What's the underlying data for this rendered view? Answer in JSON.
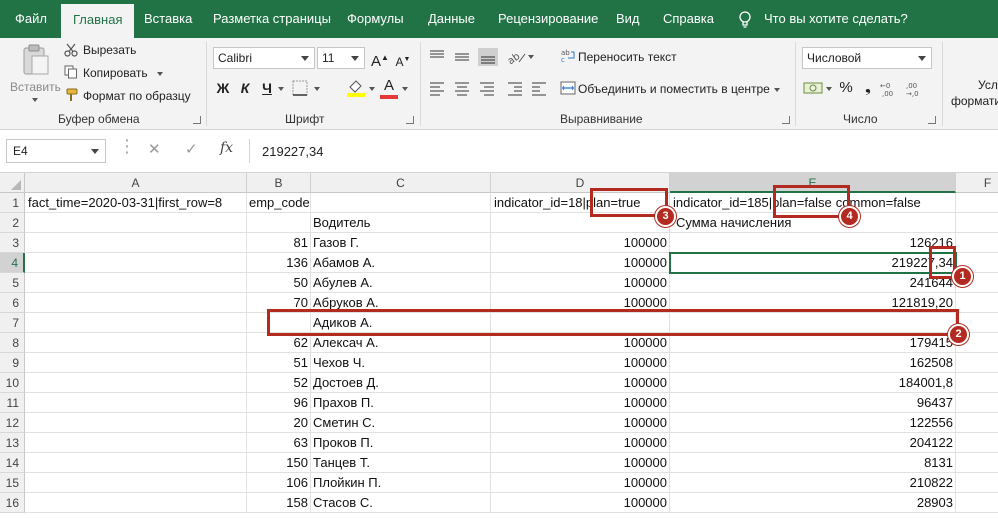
{
  "tabs": [
    {
      "label": "Файл",
      "active": false
    },
    {
      "label": "Главная",
      "active": true
    },
    {
      "label": "Вставка",
      "active": false
    },
    {
      "label": "Разметка страницы",
      "active": false
    },
    {
      "label": "Формулы",
      "active": false
    },
    {
      "label": "Данные",
      "active": false
    },
    {
      "label": "Рецензирование",
      "active": false
    },
    {
      "label": "Вид",
      "active": false
    },
    {
      "label": "Справка",
      "active": false
    }
  ],
  "tell_me": "Что вы хотите сделать?",
  "clipboard": {
    "paste": "Вставить",
    "cut": "Вырезать",
    "copy": "Копировать",
    "format_painter": "Формат по образцу",
    "label": "Буфер обмена"
  },
  "font": {
    "name": "Calibri",
    "size": "11",
    "bold": "Ж",
    "italic": "К",
    "underline": "Ч",
    "label": "Шрифт"
  },
  "alignment": {
    "wrap_text": "Переносить текст",
    "merge_center": "Объединить и поместить в центре",
    "label": "Выравнивание"
  },
  "number": {
    "format": "Числовой",
    "label": "Число"
  },
  "styles": {
    "cond_line1": "Усл",
    "cond_line2": "форматир"
  },
  "formula_bar": {
    "name_box": "E4",
    "fx": "fx",
    "content": "219227,34"
  },
  "columns": [
    "A",
    "B",
    "C",
    "D",
    "E",
    "F"
  ],
  "selected_column": "E",
  "selected_row": "4",
  "rows": [
    {
      "n": "1",
      "a": "fact_time=2020-03-31|first_row=8",
      "b": "emp_code",
      "c": "",
      "d": "indicator_id=18",
      "d2": "|plan=true",
      "e": "indicator_id=185",
      "e2": "|plan=false",
      "e3": "common=false"
    },
    {
      "n": "2",
      "a": "",
      "b": "",
      "c": "Водитель",
      "d": "",
      "e": "Сумма начисления"
    },
    {
      "n": "3",
      "a": "",
      "b": "81",
      "c": "Газов Г.",
      "d": "100000",
      "e": "126216"
    },
    {
      "n": "4",
      "a": "",
      "b": "136",
      "c": "Абамов А.",
      "d": "100000",
      "e": "219227,34"
    },
    {
      "n": "5",
      "a": "",
      "b": "50",
      "c": "Абулев А.",
      "d": "100000",
      "e": "241644"
    },
    {
      "n": "6",
      "a": "",
      "b": "70",
      "c": "Абруков А.",
      "d": "100000",
      "e": "121819,20"
    },
    {
      "n": "7",
      "a": "",
      "b": "",
      "c": "Адиков А.",
      "d": "",
      "e": ""
    },
    {
      "n": "8",
      "a": "",
      "b": "62",
      "c": "Алексач А.",
      "d": "100000",
      "e": "179415"
    },
    {
      "n": "9",
      "a": "",
      "b": "51",
      "c": "Чехов Ч.",
      "d": "100000",
      "e": "162508"
    },
    {
      "n": "10",
      "a": "",
      "b": "52",
      "c": "Достоев Д.",
      "d": "100000",
      "e": "184001,8"
    },
    {
      "n": "11",
      "a": "",
      "b": "96",
      "c": "Прахов П.",
      "d": "100000",
      "e": "96437"
    },
    {
      "n": "12",
      "a": "",
      "b": "20",
      "c": "Сметин С.",
      "d": "100000",
      "e": "122556"
    },
    {
      "n": "13",
      "a": "",
      "b": "63",
      "c": "Проков П.",
      "d": "100000",
      "e": "204122"
    },
    {
      "n": "14",
      "a": "",
      "b": "150",
      "c": "Танцев Т.",
      "d": "100000",
      "e": "8131"
    },
    {
      "n": "15",
      "a": "",
      "b": "106",
      "c": "Плойкин П.",
      "d": "100000",
      "e": "210822"
    },
    {
      "n": "16",
      "a": "",
      "b": "158",
      "c": "Стасов С.",
      "d": "100000",
      "e": "28903"
    }
  ],
  "annotations": [
    {
      "label": "1"
    },
    {
      "label": "2"
    },
    {
      "label": "3"
    },
    {
      "label": "4"
    }
  ],
  "colors": {
    "excel_green": "#217346",
    "annotation_red": "#b22a20"
  }
}
